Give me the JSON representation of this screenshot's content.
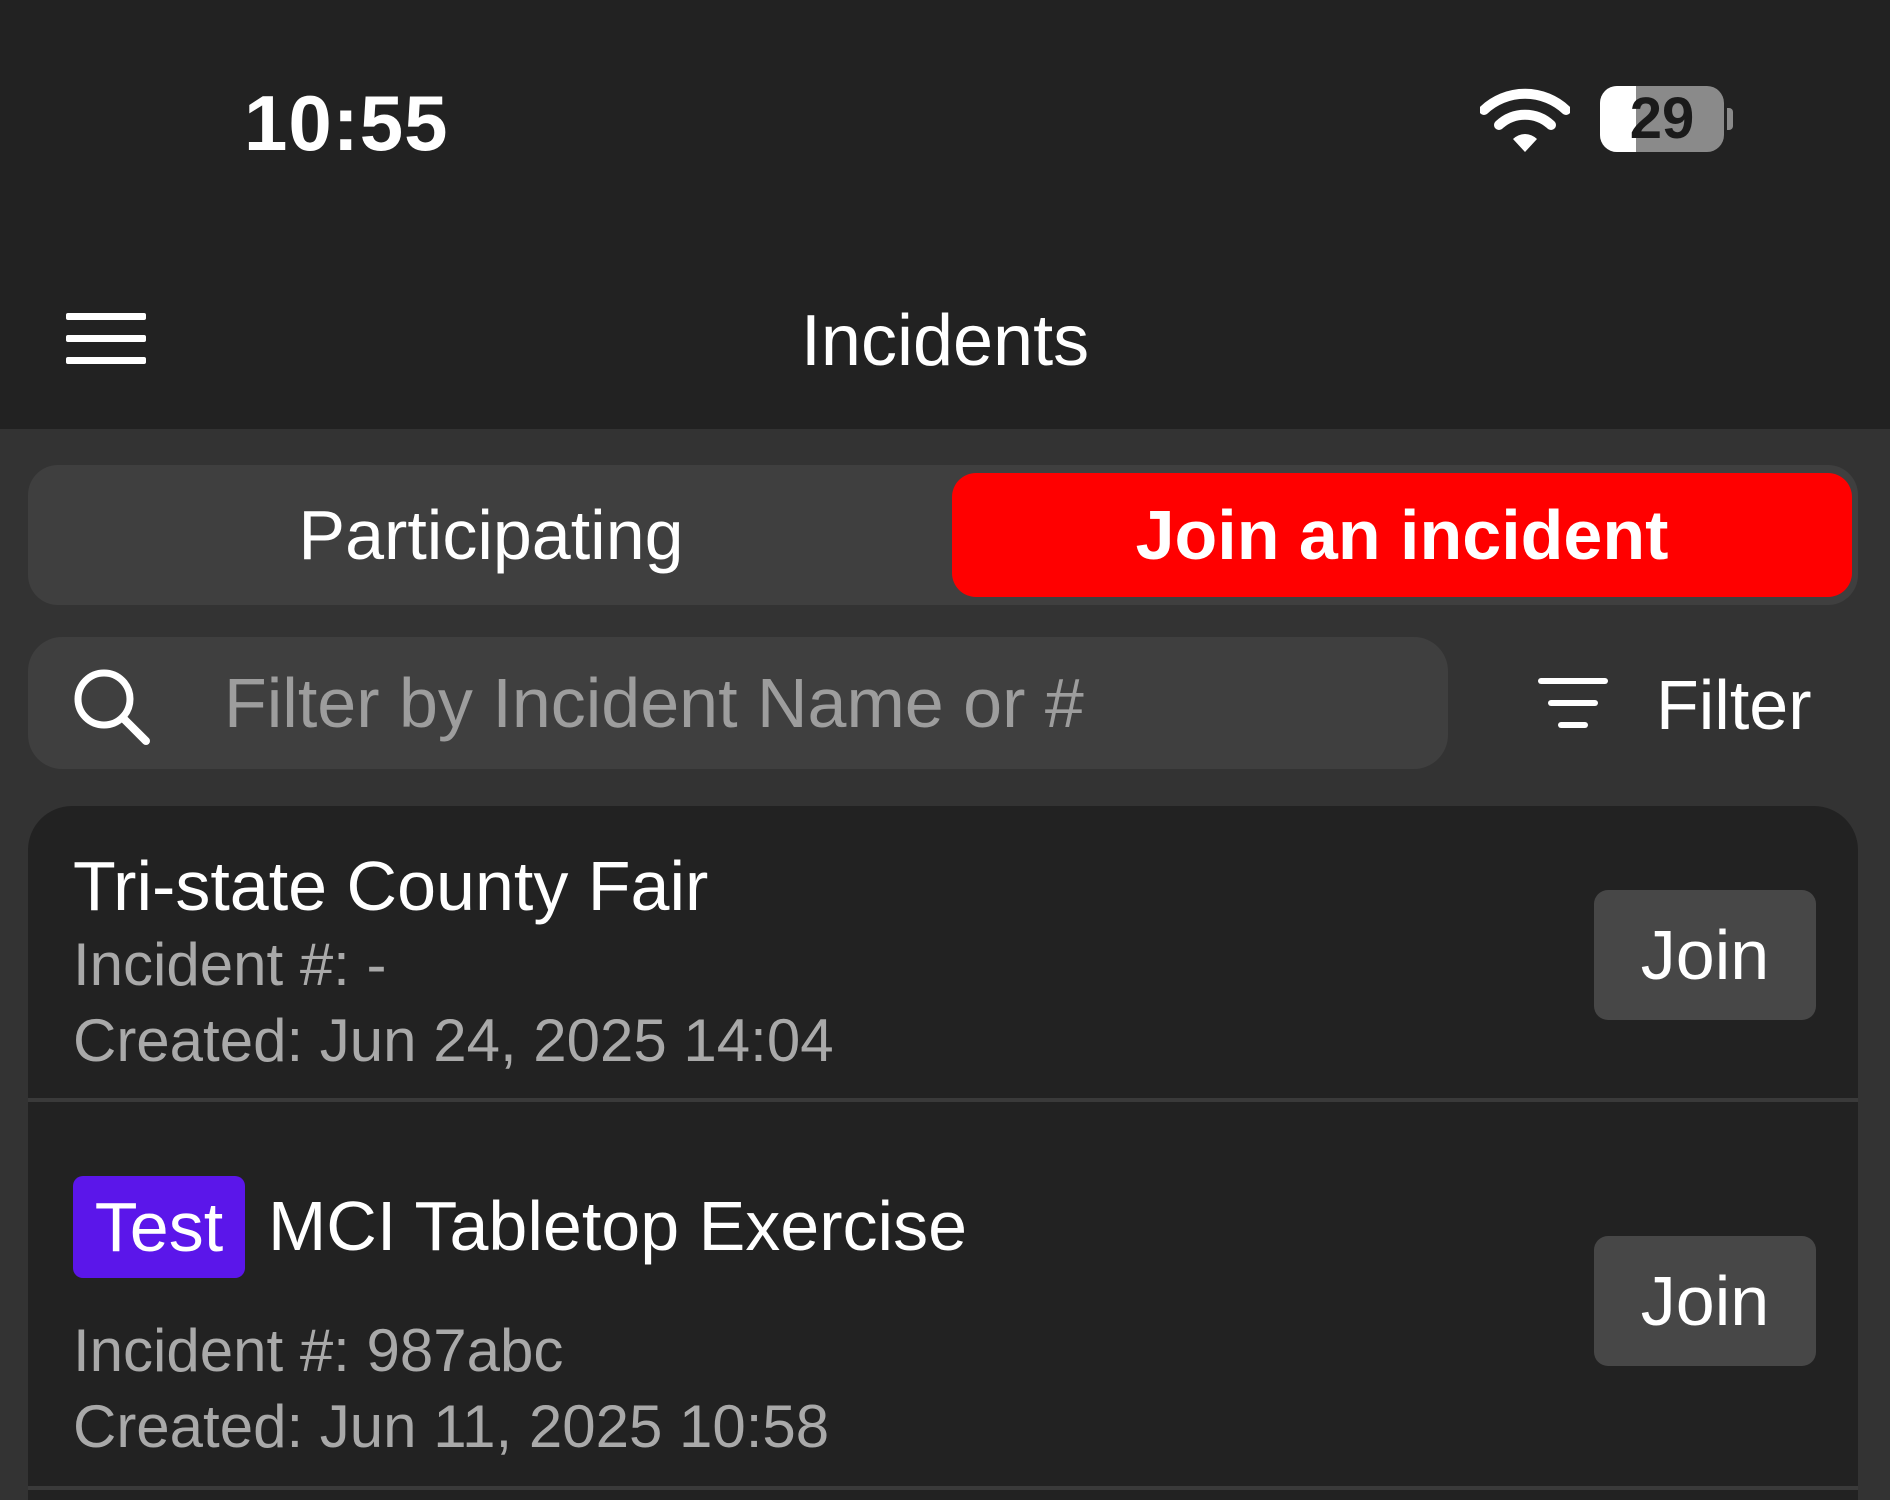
{
  "status_bar": {
    "time": "10:55",
    "battery_level": "29",
    "battery_fraction": 0.29,
    "icons": [
      "wifi-icon",
      "battery-icon"
    ]
  },
  "header": {
    "title": "Incidents",
    "menu_icon": "hamburger-menu-icon"
  },
  "tabs": [
    {
      "label": "Participating",
      "active": false
    },
    {
      "label": "Join an incident",
      "active": true
    }
  ],
  "search": {
    "value": "",
    "placeholder": "Filter by Incident Name or #",
    "icon": "search-icon"
  },
  "filter": {
    "label": "Filter",
    "icon": "filter-lines-icon"
  },
  "incidents": [
    {
      "name": "Tri-state County Fair",
      "tag": "",
      "number": "Incident #: -",
      "created": "Created: Jun 24, 2025 14:04",
      "action": "Join"
    },
    {
      "name": "MCI Tabletop Exercise",
      "tag": "Test",
      "number": "Incident #: 987abc",
      "created": "Created: Jun 11, 2025 10:58",
      "action": "Join"
    }
  ],
  "colors": {
    "accent": "#ff0000",
    "tag_test": "#5b16ea",
    "background": "#333333",
    "header": "#222222",
    "card": "#222222",
    "button": "#474747"
  }
}
